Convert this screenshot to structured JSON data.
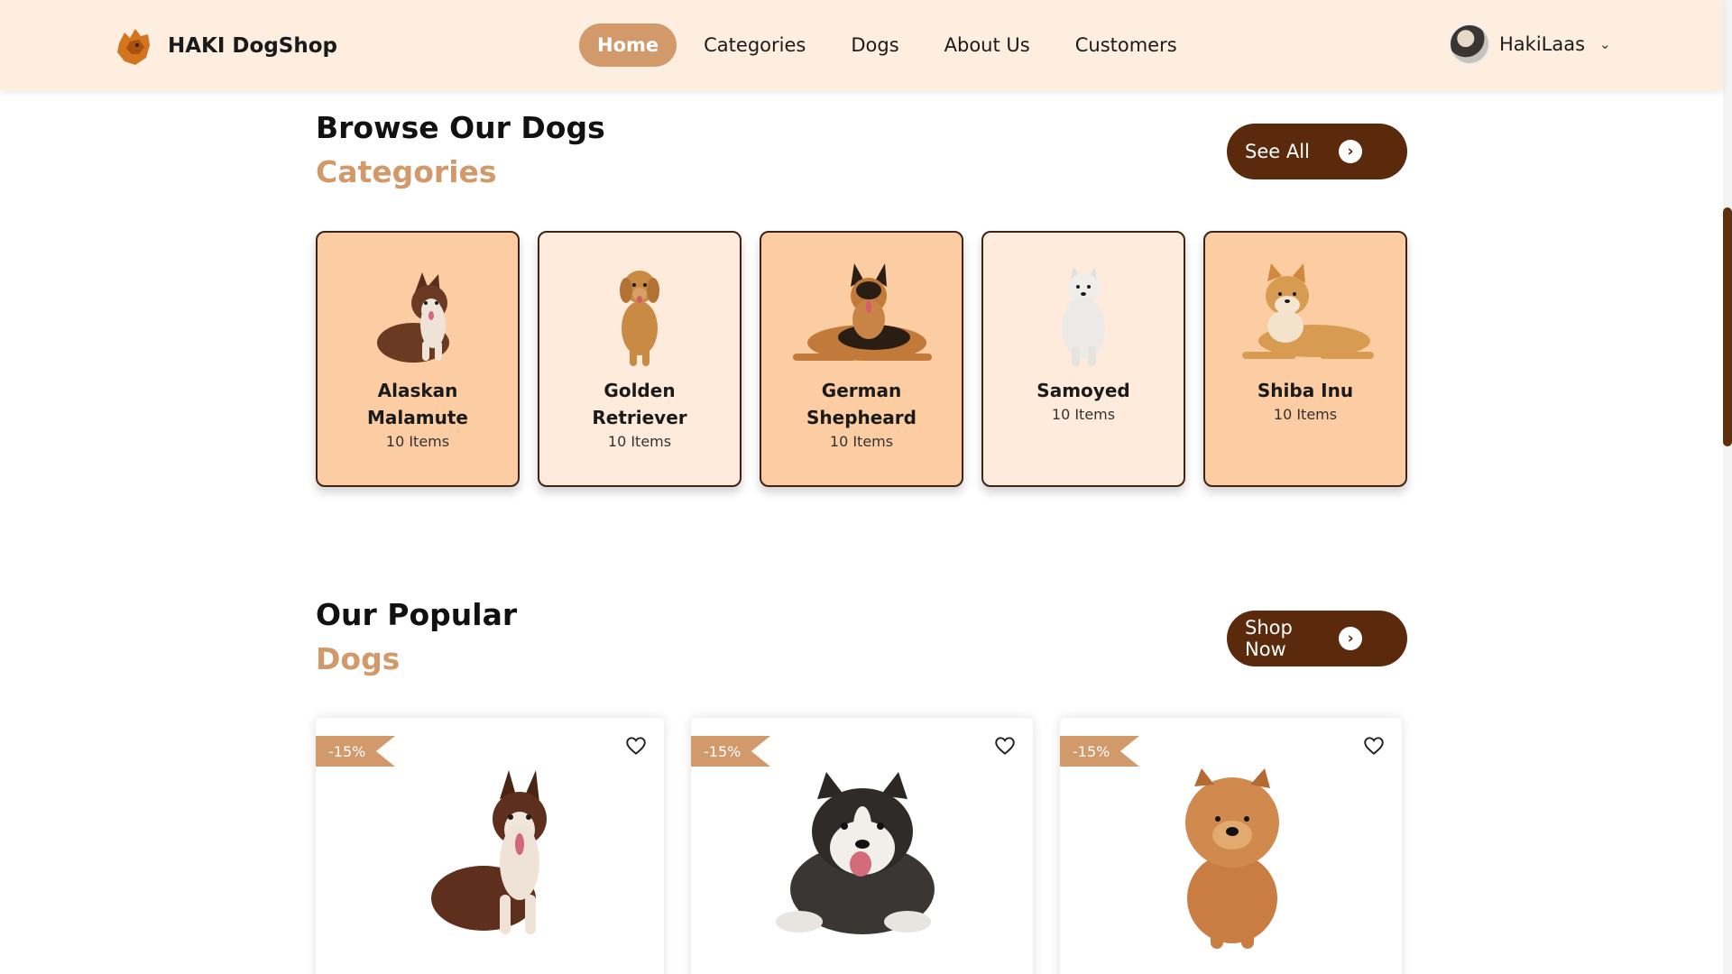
{
  "header": {
    "brand_name": "HAKI DogShop",
    "nav": [
      "Home",
      "Categories",
      "Dogs",
      "About Us",
      "Customers"
    ],
    "active_nav": "Home",
    "user_name": "HakiLaas"
  },
  "categories_section": {
    "title": "Browse Our Dogs",
    "subtitle": "Categories",
    "cta_label": "See All",
    "items": [
      {
        "name": "Alaskan Malamute",
        "count": "10 Items"
      },
      {
        "name": "Golden Retriever",
        "count": "10 Items"
      },
      {
        "name": "German Shepheard",
        "count": "10 Items"
      },
      {
        "name": "Samoyed",
        "count": "10 Items"
      },
      {
        "name": "Shiba Inu",
        "count": "10 Items"
      }
    ]
  },
  "popular_section": {
    "title": "Our Popular",
    "subtitle": "Dogs",
    "cta_label": "Shop Now",
    "products": [
      {
        "discount": "-15%",
        "image": "alaskan-malamute-sitting"
      },
      {
        "discount": "-15%",
        "image": "alaskan-malamute-lying"
      },
      {
        "discount": "-15%",
        "image": "chow-chow-sitting"
      }
    ]
  },
  "colors": {
    "header_bg": "#fdeedf",
    "accent": "#d29a6b",
    "dark_brown": "#5b2a0c",
    "card_orange": "#fccca2",
    "card_light": "#feebdb"
  }
}
